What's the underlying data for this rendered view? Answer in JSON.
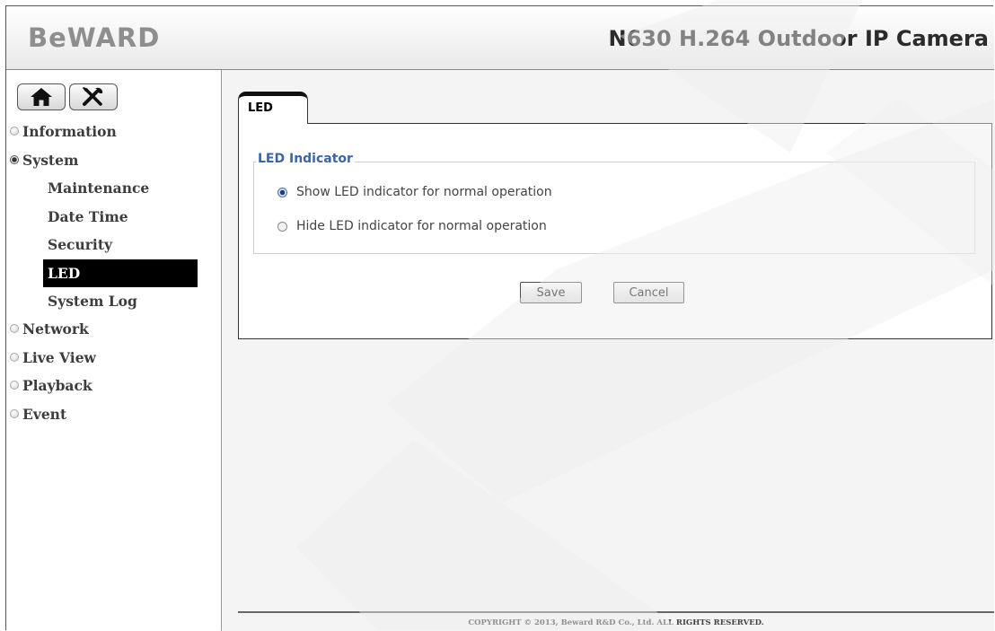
{
  "header": {
    "logo": "BeWARD",
    "camera_title": "N630 H.264 Outdoor IP Camera"
  },
  "toolbar": {
    "home_icon": "home-icon",
    "settings_icon": "tools-icon"
  },
  "sidebar": {
    "items": [
      {
        "label": "Information",
        "level": 0,
        "expanded": false
      },
      {
        "label": "System",
        "level": 0,
        "expanded": true
      },
      {
        "label": "Maintenance",
        "level": 1
      },
      {
        "label": "Date Time",
        "level": 1
      },
      {
        "label": "Security",
        "level": 1
      },
      {
        "label": "LED",
        "level": 1,
        "active": true
      },
      {
        "label": "System Log",
        "level": 1
      },
      {
        "label": "Network",
        "level": 0,
        "expanded": false
      },
      {
        "label": "Live View",
        "level": 0,
        "expanded": false
      },
      {
        "label": "Playback",
        "level": 0,
        "expanded": false
      },
      {
        "label": "Event",
        "level": 0,
        "expanded": false
      }
    ]
  },
  "main": {
    "tab_label": "LED",
    "fieldset_legend": "LED Indicator",
    "options": [
      {
        "label": "Show LED indicator for normal operation",
        "checked": true
      },
      {
        "label": "Hide LED indicator for normal operation",
        "checked": false
      }
    ],
    "save_label": "Save",
    "cancel_label": "Cancel"
  },
  "footer": {
    "copyright": "COPYRIGHT © 2013, Beward R&D Co., Ltd. ALL RIGHTS RESERVED."
  },
  "colors": {
    "legend_blue": "#3c64a8",
    "active_menu_bg": "#000000",
    "watermark": "#eeeeee"
  }
}
